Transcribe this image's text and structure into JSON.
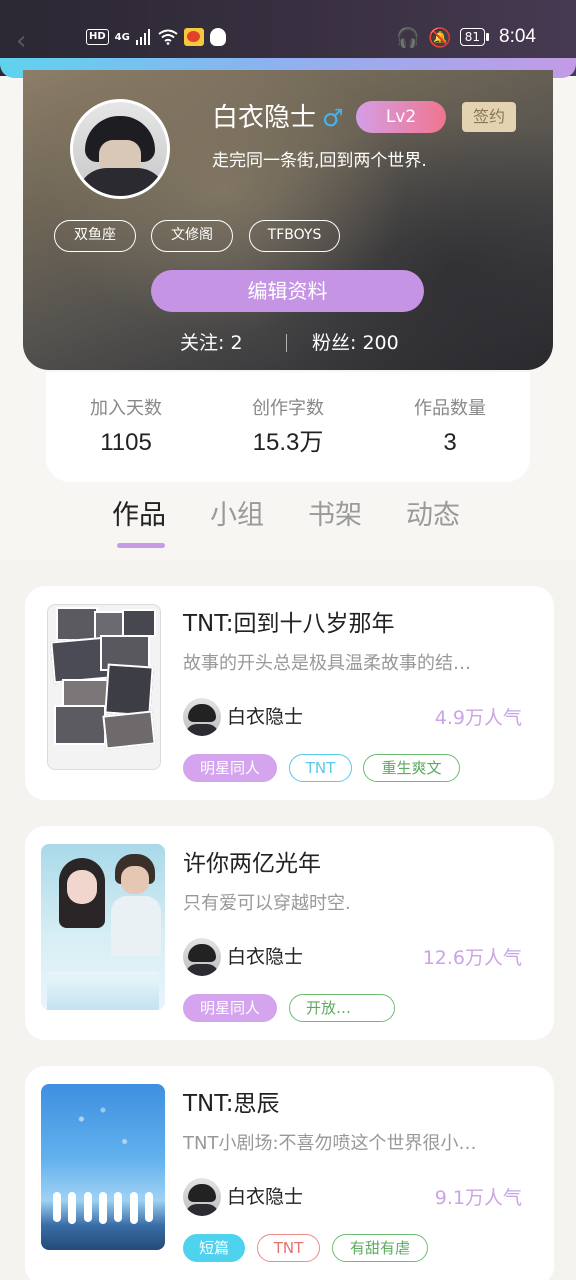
{
  "status_bar": {
    "hd": "HD",
    "network": "4G",
    "battery": "81",
    "time": "8:04"
  },
  "profile": {
    "name": "白衣隐士",
    "level": "Lv2",
    "sign_badge": "签约",
    "signature": "走完同一条街,回到两个世界.",
    "tags": [
      "双鱼座",
      "文修阁",
      "TFBOYS"
    ],
    "edit_label": "编辑资料",
    "following_label": "关注:",
    "following_count": "2",
    "followers_label": "粉丝:",
    "followers_count": "200"
  },
  "stats": [
    {
      "label": "加入天数",
      "value": "1105"
    },
    {
      "label": "创作字数",
      "value": "15.3万"
    },
    {
      "label": "作品数量",
      "value": "3"
    }
  ],
  "tabs": [
    "作品",
    "小组",
    "书架",
    "动态"
  ],
  "active_tab": "作品",
  "accent_color": "#c694e5",
  "works": [
    {
      "title": "TNT:回到十八岁那年",
      "desc": "故事的开头总是极具温柔故事的结…",
      "author": "白衣隐士",
      "popularity": "4.9万人气",
      "tags": [
        "明星同人",
        "TNT",
        "重生爽文"
      ]
    },
    {
      "title": "许你两亿光年",
      "desc": "只有爱可以穿越时空.",
      "author": "白衣隐士",
      "popularity": "12.6万人气",
      "tags": [
        "明星同人",
        "开放…"
      ]
    },
    {
      "title": "TNT:思辰",
      "desc": "TNT小剧场:不喜勿喷这个世界很小…",
      "author": "白衣隐士",
      "popularity": "9.1万人气",
      "tags": [
        "短篇",
        "TNT",
        "有甜有虐"
      ]
    }
  ]
}
